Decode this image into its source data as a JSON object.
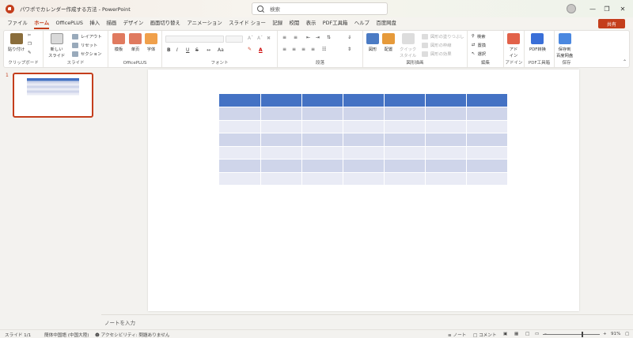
{
  "titlebar": {
    "doc_title": "パワポでカレンダー作成する方法 - PowerPoint",
    "search_placeholder": "検索"
  },
  "menu": {
    "tabs": [
      "ファイル",
      "ホーム",
      "OfficePLUS",
      "挿入",
      "描画",
      "デザイン",
      "画面切り替え",
      "アニメーション",
      "スライド ショー",
      "記録",
      "校閲",
      "表示",
      "PDF工具箱",
      "ヘルプ",
      "百度网盘"
    ],
    "active": "ホーム",
    "share_label": "共有"
  },
  "ribbon": {
    "clipboard": {
      "paste": "貼り付け",
      "label": "クリップボード"
    },
    "slides": {
      "new_slide": "新しい\nスライド",
      "layout": "レイアウト",
      "reset": "リセット",
      "section": "セクション",
      "label": "スライド"
    },
    "officeplus": {
      "template": "模板",
      "single": "单页",
      "font": "字体",
      "label": "OfficePLUS"
    },
    "font": {
      "label": "フォント",
      "bold": "B",
      "italic": "I",
      "underline": "U",
      "strike": "S"
    },
    "paragraph": {
      "label": "段落"
    },
    "drawing": {
      "shape": "図形",
      "arrange": "配置",
      "quick_style": "クイック\nスタイル",
      "fill": "図形の塗りつぶし",
      "outline": "図形の枠線",
      "effects": "図形の効果",
      "label": "図形描画"
    },
    "editing": {
      "find": "検索",
      "replace": "置換",
      "select": "選択",
      "label": "編集"
    },
    "addin": {
      "button": "アド\nイン",
      "label": "アドイン"
    },
    "pdf": {
      "button": "PDF转换",
      "label": "PDF工具箱"
    },
    "save": {
      "button": "保存到\n百度网盘",
      "label": "保存"
    }
  },
  "slides_pane": {
    "slide_number": "1"
  },
  "notes": {
    "placeholder": "ノートを入力"
  },
  "statusbar": {
    "slide_info": "スライド 1/1",
    "language": "簡体中国語 (中国大陸)",
    "accessibility": "アクセシビリティ: 問題ありません",
    "notes": "ノート",
    "comments": "コメント",
    "zoom": "91%"
  },
  "colors": {
    "accent": "#c43e1c",
    "table_header": "#4472c4",
    "table_band_dark": "#cfd5ea",
    "table_band_light": "#e9ebf5"
  }
}
